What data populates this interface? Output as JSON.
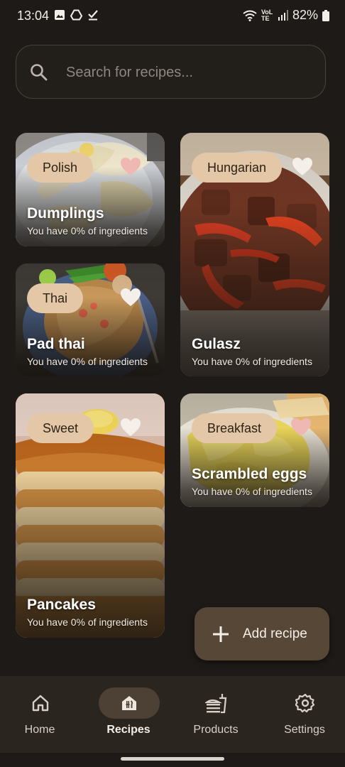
{
  "status_bar": {
    "time": "13:04",
    "battery": "82%",
    "network_label": "VoLTE",
    "icons": [
      "image-icon",
      "drive-icon",
      "check-download-icon",
      "wifi-icon",
      "signal-icon",
      "battery-icon"
    ]
  },
  "search": {
    "placeholder": "Search for recipes..."
  },
  "recipes": [
    {
      "name": "Dumplings",
      "category": "Polish",
      "ingredients_text": "You have 0% of ingredients",
      "favorite": true,
      "accent_color": "#f0b8b2"
    },
    {
      "name": "Gulasz",
      "category": "Hungarian",
      "ingredients_text": "You have 0% of ingredients",
      "favorite": false,
      "accent_color": "#f4efe9"
    },
    {
      "name": "Pad thai",
      "category": "Thai",
      "ingredients_text": "You have 0% of ingredients",
      "favorite": false,
      "accent_color": "#f4efe9"
    },
    {
      "name": "Scrambled eggs",
      "category": "Breakfast",
      "ingredients_text": "You have 0% of ingredients",
      "favorite": true,
      "accent_color": "#f0b8b2"
    },
    {
      "name": "Pancakes",
      "category": "Sweet",
      "ingredients_text": "You have 0% of ingredients",
      "favorite": false,
      "accent_color": "#f4efe9"
    }
  ],
  "fab": {
    "label": "Add recipe",
    "icon": "plus-icon"
  },
  "nav": {
    "items": [
      {
        "label": "Home",
        "icon": "home-icon",
        "active": false
      },
      {
        "label": "Recipes",
        "icon": "recipes-icon",
        "active": true
      },
      {
        "label": "Products",
        "icon": "products-icon",
        "active": false
      },
      {
        "label": "Settings",
        "icon": "gear-icon",
        "active": false
      }
    ]
  },
  "colors": {
    "background": "#1d1a17",
    "tag": "#e3c7a6",
    "fab": "#574736",
    "nav_bar": "#2b2520",
    "nav_active_pill": "#4d4136"
  }
}
